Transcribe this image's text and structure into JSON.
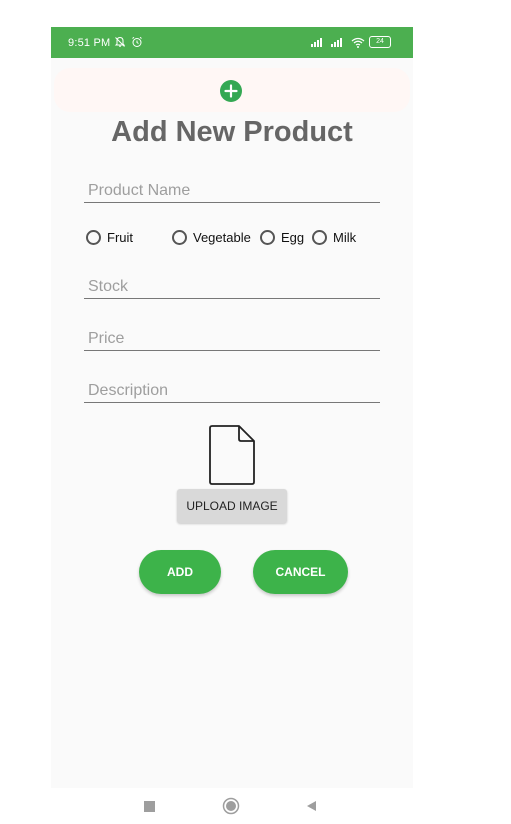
{
  "status_bar": {
    "time": "9:51 PM",
    "battery": "24",
    "left_icons": [
      "muted-bell-icon",
      "alarm-clock-icon"
    ],
    "right_icons": [
      "signal-icon",
      "signal-icon",
      "wifi-icon",
      "battery-icon"
    ]
  },
  "header": {
    "add_icon": "plus-circle-icon",
    "title": "Add New Product"
  },
  "form": {
    "product_name_placeholder": "Product Name",
    "categories": [
      {
        "label": "Fruit",
        "selected": false
      },
      {
        "label": "Vegetable",
        "selected": false
      },
      {
        "label": "Egg",
        "selected": false
      },
      {
        "label": "Milk",
        "selected": false
      }
    ],
    "stock_placeholder": "Stock",
    "price_placeholder": "Price",
    "description_placeholder": "Description",
    "file_icon": "file-icon",
    "upload_label": "UPLOAD IMAGE",
    "add_label": "ADD",
    "cancel_label": "CANCEL"
  },
  "nav": {
    "items": [
      "recent-apps-icon",
      "home-icon",
      "back-icon"
    ]
  },
  "colors": {
    "status_bar": "#4caf50",
    "primary_button": "#3db34a",
    "add_icon": "#34a853",
    "title": "#666666",
    "upload_button": "#d9d9d9"
  }
}
